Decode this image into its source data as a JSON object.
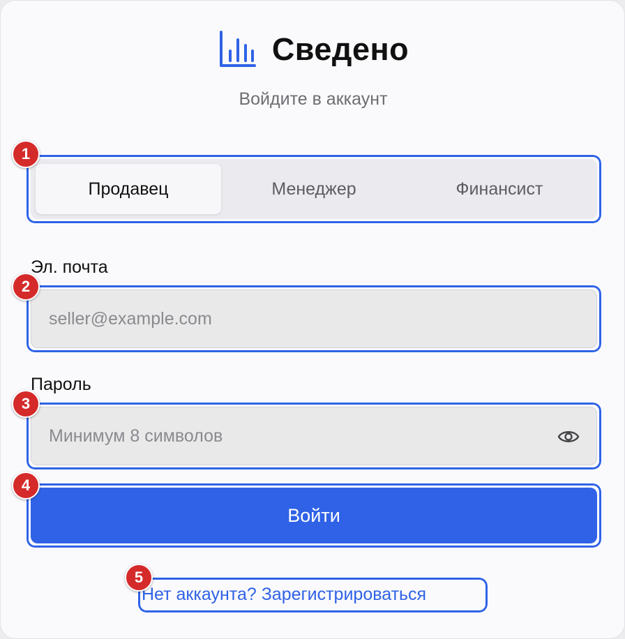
{
  "brand": {
    "name": "Сведено",
    "icon": "bar-chart-icon"
  },
  "subtitle": "Войдите в аккаунт",
  "roles": {
    "items": [
      "Продавец",
      "Менеджер",
      "Финансист"
    ],
    "selected": "Продавец"
  },
  "email": {
    "label": "Эл. почта",
    "placeholder": "seller@example.com"
  },
  "password": {
    "label": "Пароль",
    "placeholder": "Минимум 8 символов",
    "toggle_icon": "eye-icon"
  },
  "submit": {
    "label": "Войти"
  },
  "register_link": {
    "label": "Нет аккаунта? Зарегистрироваться"
  },
  "annotations": [
    "1",
    "2",
    "3",
    "4",
    "5"
  ],
  "colors": {
    "accent": "#2f62e6",
    "badge": "#d52a2a",
    "background": "#fafafc"
  }
}
